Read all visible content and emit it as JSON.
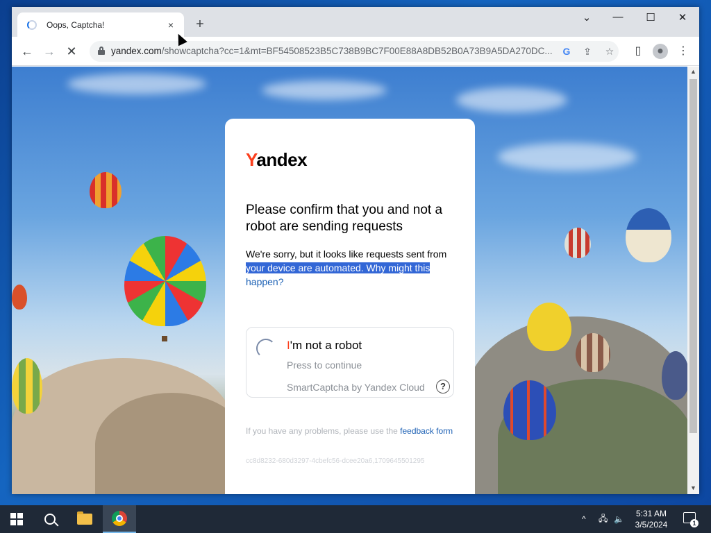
{
  "browser": {
    "tab": {
      "title": "Oops, Captcha!",
      "close_icon": "×"
    },
    "new_tab_icon": "+",
    "window_controls": {
      "tab_search": "⌄",
      "minimize": "—",
      "maximize": "☐",
      "close": "✕"
    },
    "toolbar": {
      "back_icon": "←",
      "forward_icon": "→",
      "stop_icon": "✕",
      "url_host": "yandex.com",
      "url_path": "/showcaptcha?cc=1&mt=BF54508523B5C738B9BC7F00E88A8DB52B0A73B9A5DA270DC...",
      "google_icon": "G",
      "share_icon": "⇪",
      "bookmark_icon": "☆",
      "sidepanel_icon": "▯",
      "profile_icon": "●",
      "menu_icon": "⋮"
    }
  },
  "page": {
    "logo_y": "Y",
    "logo_rest": "andex",
    "heading": "Please confirm that you and not a robot are sending requests",
    "desc_plain": "We're sorry, but it looks like requests sent from ",
    "desc_selected": "your device are automated.",
    "desc_link_selected": "  Why might this",
    "desc_link_rest": "happen?",
    "captcha": {
      "title_i": "I",
      "title_rest": "'m not a robot",
      "subtitle": "Press to continue",
      "brand": "SmartCaptcha by Yandex Cloud",
      "help_icon": "?"
    },
    "footer_text": "If you have any problems, please use the ",
    "footer_link": "feedback form",
    "hash": "cc8d8232-680d3297-4cbefc56-dcee20a6,1709645501295"
  },
  "taskbar": {
    "clock_time": "5:31 AM",
    "clock_date": "3/5/2024",
    "tray_chevron": "^",
    "network_icon": "🖧",
    "volume_icon": "🔈",
    "notification_count": "1"
  }
}
